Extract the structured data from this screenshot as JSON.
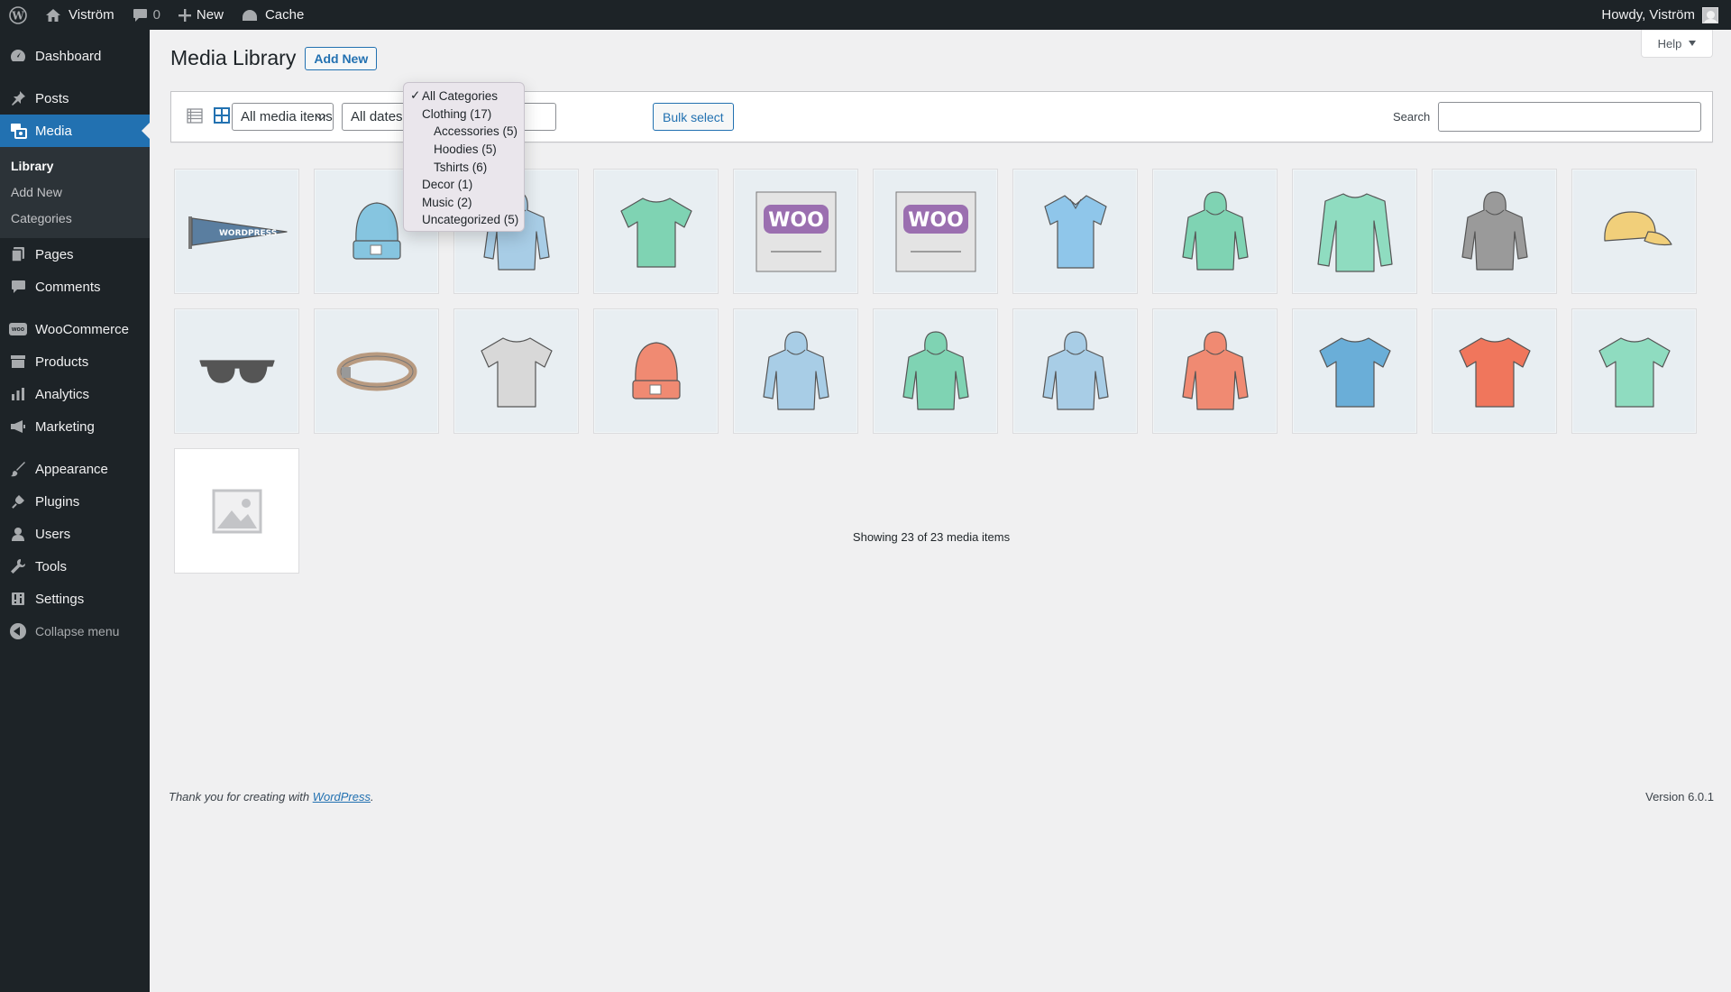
{
  "adminbar": {
    "site_name": "Viström",
    "comments_count": "0",
    "new_label": "New",
    "cache_label": "Cache",
    "greeting": "Howdy, Viström"
  },
  "sidebar": {
    "items": [
      {
        "label": "Dashboard",
        "icon": "dashboard-icon"
      },
      {
        "label": "Posts",
        "icon": "pin-icon"
      },
      {
        "label": "Media",
        "icon": "media-icon"
      },
      {
        "label": "Pages",
        "icon": "pages-icon"
      },
      {
        "label": "Comments",
        "icon": "comments-icon"
      },
      {
        "label": "WooCommerce",
        "icon": "woo-icon"
      },
      {
        "label": "Products",
        "icon": "products-icon"
      },
      {
        "label": "Analytics",
        "icon": "analytics-icon"
      },
      {
        "label": "Marketing",
        "icon": "megaphone-icon"
      },
      {
        "label": "Appearance",
        "icon": "brush-icon"
      },
      {
        "label": "Plugins",
        "icon": "plug-icon"
      },
      {
        "label": "Users",
        "icon": "user-icon"
      },
      {
        "label": "Tools",
        "icon": "wrench-icon"
      },
      {
        "label": "Settings",
        "icon": "settings-icon"
      }
    ],
    "media_submenu": [
      "Library",
      "Add New",
      "Categories"
    ],
    "collapse_label": "Collapse menu"
  },
  "page": {
    "title": "Media Library",
    "add_new": "Add New",
    "help": "Help"
  },
  "toolbar": {
    "media_filter": "All media items",
    "date_filter": "All dates",
    "bulk_select": "Bulk select",
    "search_label": "Search",
    "search_value": ""
  },
  "category_dropdown": {
    "options": [
      {
        "label": "All Categories",
        "level": 0,
        "selected": true
      },
      {
        "label": "Clothing (17)",
        "level": 0,
        "selected": false
      },
      {
        "label": "Accessories (5)",
        "level": 1,
        "selected": false
      },
      {
        "label": "Hoodies (5)",
        "level": 1,
        "selected": false
      },
      {
        "label": "Tshirts (6)",
        "level": 1,
        "selected": false
      },
      {
        "label": "Decor (1)",
        "level": 0,
        "selected": false
      },
      {
        "label": "Music (2)",
        "level": 0,
        "selected": false
      },
      {
        "label": "Uncategorized (5)",
        "level": 0,
        "selected": false
      }
    ]
  },
  "media_items": [
    {
      "type": "pennant",
      "color": "#5a7ea0"
    },
    {
      "type": "beanie",
      "color": "#86c5e0"
    },
    {
      "type": "hoodie",
      "color": "#a8cde6"
    },
    {
      "type": "tshirt",
      "color": "#7fd3b3"
    },
    {
      "type": "woo-album",
      "color": "#9b6fb0"
    },
    {
      "type": "woo-album",
      "color": "#9b6fb0"
    },
    {
      "type": "polo",
      "color": "#8fc6ea"
    },
    {
      "type": "hoodie",
      "color": "#7fd3b3"
    },
    {
      "type": "longsleeve",
      "color": "#8fdcc0"
    },
    {
      "type": "hoodie",
      "color": "#9a9a9a"
    },
    {
      "type": "cap",
      "color": "#f1cf7a"
    },
    {
      "type": "sunglasses",
      "color": "#555555"
    },
    {
      "type": "belt",
      "color": "#b89a80"
    },
    {
      "type": "tshirt",
      "color": "#d8d8d8"
    },
    {
      "type": "beanie",
      "color": "#f08a72"
    },
    {
      "type": "hoodie",
      "color": "#a8cde6"
    },
    {
      "type": "hoodie",
      "color": "#7fd3b3"
    },
    {
      "type": "hoodie",
      "color": "#a8cde6"
    },
    {
      "type": "hoodie",
      "color": "#f08a72"
    },
    {
      "type": "tshirt",
      "color": "#6aaed8"
    },
    {
      "type": "tshirt",
      "color": "#f0765c"
    },
    {
      "type": "tshirt",
      "color": "#8fdcc0"
    },
    {
      "type": "placeholder",
      "color": "#c3c4c7"
    }
  ],
  "status": {
    "count_text": "Showing 23 of 23 media items"
  },
  "footer": {
    "thanks_prefix": "Thank you for creating with ",
    "link_text": "WordPress",
    "thanks_suffix": ".",
    "version": "Version 6.0.1"
  }
}
